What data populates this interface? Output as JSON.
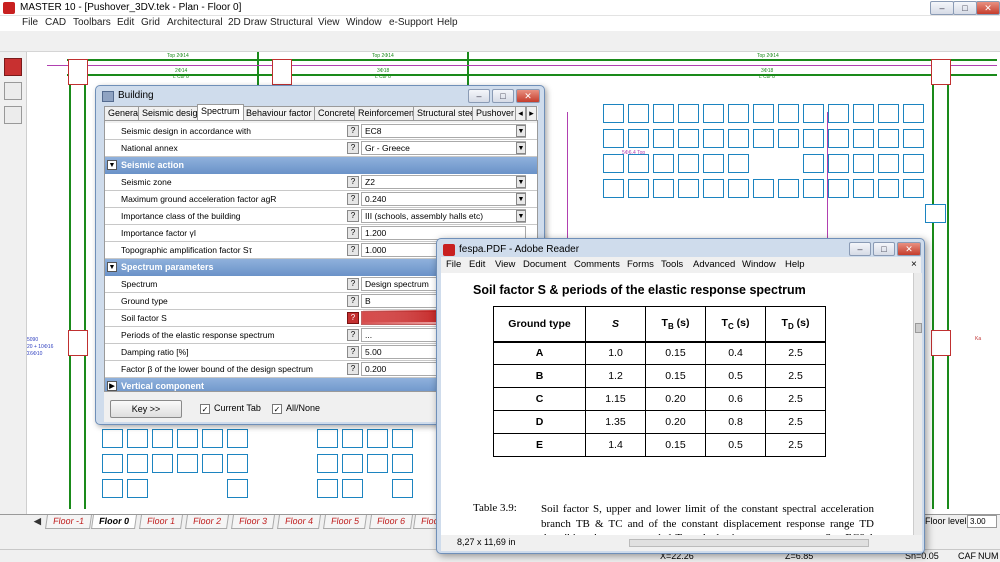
{
  "app": {
    "title": "MASTER 10 - [Pushover_3DV.tek - Plan - Floor 0]",
    "window_buttons": [
      "–",
      "□",
      "✕"
    ]
  },
  "menu": [
    "File",
    "CAD",
    "Toolbars",
    "Edit",
    "Grid",
    "Architectural",
    "2D Draw",
    "Structural",
    "View",
    "Window",
    "e-Support",
    "Help"
  ],
  "plan_labels": {
    "top1": "Top 2Φ14",
    "top2": "Top 2Φ14",
    "top3": "Top 2Φ14",
    "bot1": "2Φ14",
    "bot1b": "L C8/ 8",
    "bot2": "3Φ18",
    "bot2b": "L C8/ 8",
    "bot3": "3Φ18",
    "bot3b": "L C8/ 8",
    "left1": "2Φ16 Top",
    "left2": "5090",
    "left3": "20 + 10Φ16",
    "left4": "Σ6Φ10",
    "left5": "Top 2Φ16",
    "left6": "Top 2Φ16",
    "mid1": "5Φ6.4 Top",
    "right1": "2Φ16 Bottom",
    "right2": "Ka",
    "right3": "Top 2Φ16",
    "right4": "2Φ20"
  },
  "floor_tabs": [
    "Floor -1",
    "Floor 0",
    "Floor 1",
    "Floor 2",
    "Floor 3",
    "Floor 4",
    "Floor 5",
    "Floor 6",
    "Floor"
  ],
  "floor_level_label": "Floor level:",
  "floor_level_value": "3.00",
  "status": {
    "x": "X=22.26",
    "z": "Z=6.85",
    "sn": "Sn=0.05",
    "caf": "CAF",
    "num": "NUM"
  },
  "building_dialog": {
    "title": "Building",
    "buttons": [
      "–",
      "□",
      "✕"
    ],
    "tabs": [
      "General",
      "Seismic design",
      "Spectrum",
      "Behaviour factor q",
      "Concrete",
      "Reinforcement",
      "Structural steel",
      "Pushover"
    ],
    "active_tab": "Spectrum",
    "rows": [
      {
        "kind": "prop",
        "label": "Seismic design in accordance with",
        "value": "EC8",
        "dropdown": true
      },
      {
        "kind": "prop",
        "label": "National annex",
        "value": "Gr - Greece",
        "dropdown": true
      },
      {
        "kind": "section",
        "label": "Seismic action",
        "toggle": "▼"
      },
      {
        "kind": "prop",
        "label": "Seismic zone",
        "value": "Z2",
        "dropdown": true
      },
      {
        "kind": "prop",
        "label": "Maximum ground acceleration factor agR",
        "value": "0.240",
        "dropdown": true
      },
      {
        "kind": "prop",
        "label": "Importance class of the building",
        "value": "III (schools, assembly halls etc)",
        "dropdown": true
      },
      {
        "kind": "prop",
        "label": "Importance factor γI",
        "value": "1.200",
        "dropdown": false
      },
      {
        "kind": "prop",
        "label": "Topographic amplification factor Sτ",
        "value": "1.000",
        "dropdown": false
      },
      {
        "kind": "section",
        "label": "Spectrum parameters",
        "toggle": "▼"
      },
      {
        "kind": "prop",
        "label": "Spectrum",
        "value": "Design spectrum",
        "dropdown": false
      },
      {
        "kind": "prop",
        "label": "Ground type",
        "value": "B",
        "dropdown": false
      },
      {
        "kind": "prop",
        "label": "Soil factor S",
        "value": "",
        "dropdown": false,
        "highlight": true
      },
      {
        "kind": "prop",
        "label": "Periods of the elastic response spectrum",
        "value": "...",
        "dropdown": false
      },
      {
        "kind": "prop",
        "label": "Damping ratio [%]",
        "value": "5.00",
        "dropdown": false
      },
      {
        "kind": "prop",
        "label": "Factor β of the lower bound of the design spectrum",
        "value": "0.200",
        "dropdown": false
      },
      {
        "kind": "section",
        "label": "Vertical component",
        "toggle": "▶"
      }
    ],
    "key_button": "Key >>",
    "current_tab_label": "Current Tab",
    "all_none_label": "All/None",
    "question_mark": "?"
  },
  "pdf_window": {
    "title": "fespa.PDF - Adobe Reader",
    "buttons": [
      "–",
      "□",
      "✕"
    ],
    "menu": [
      "File",
      "Edit",
      "View",
      "Document",
      "Comments",
      "Forms",
      "Tools",
      "Advanced",
      "Window",
      "Help"
    ],
    "close_x": "×",
    "heading": "Soil factor S & periods of the elastic response spectrum",
    "table_header": [
      "Ground type",
      "S",
      "TB (s)",
      "TC (s)",
      "TD (s)"
    ],
    "table_rows": [
      [
        "A",
        "1.0",
        "0.15",
        "0.4",
        "2.5"
      ],
      [
        "B",
        "1.2",
        "0.15",
        "0.5",
        "2.5"
      ],
      [
        "C",
        "1.15",
        "0.20",
        "0.6",
        "2.5"
      ],
      [
        "D",
        "1.35",
        "0.20",
        "0.8",
        "2.5"
      ],
      [
        "E",
        "1.4",
        "0.15",
        "0.5",
        "2.5"
      ]
    ],
    "caption_num": "Table 3.9:",
    "caption": "Soil factor S, upper and lower limit of the constant spectral acceleration branch TB & TC and of the constant displacement response range TD describing the recommended Type 1 elastic response spectra. See EC8-1 Table 3.2 and Greek National Annex.",
    "page_size": "8,27 x 11,69 in"
  }
}
